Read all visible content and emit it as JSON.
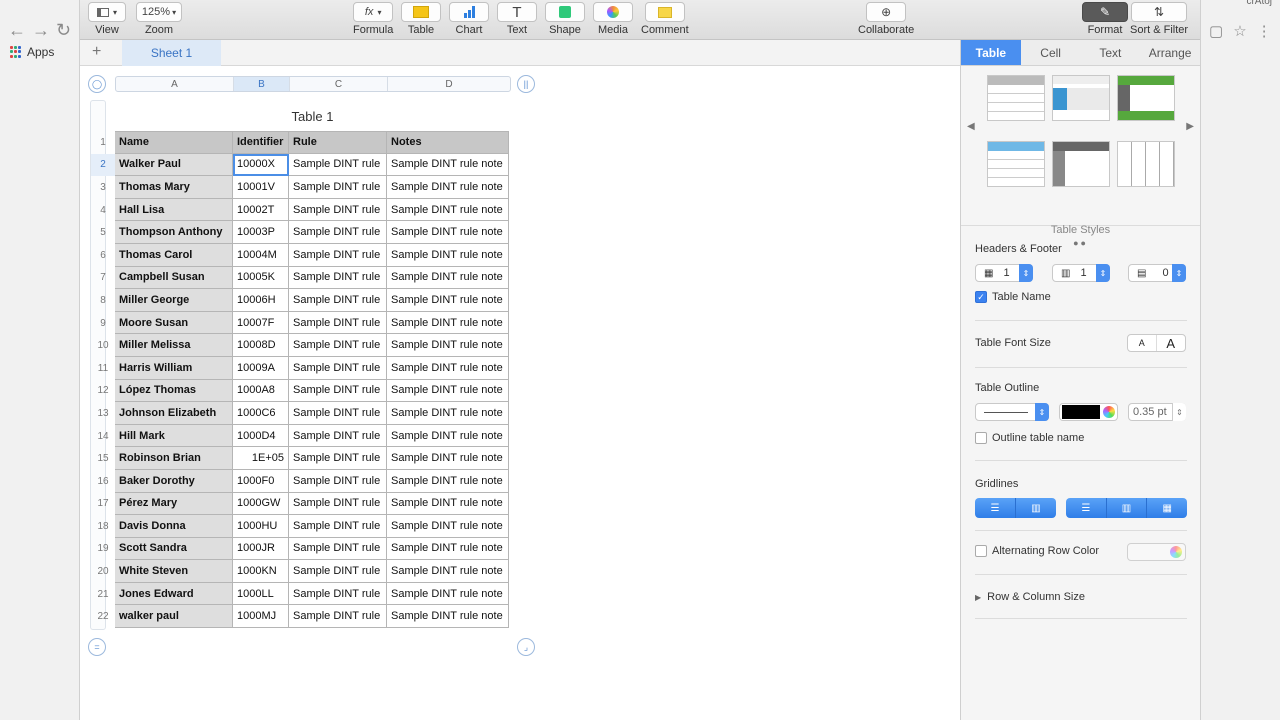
{
  "browser": {
    "apps_label": "Apps",
    "corner_text": "crAtoj"
  },
  "toolbar": {
    "view_label": "View",
    "zoom_value": "125%",
    "zoom_label": "Zoom",
    "formula_label": "Formula",
    "formula_icon_text": "fx",
    "table_label": "Table",
    "chart_label": "Chart",
    "text_label": "Text",
    "text_icon": "T",
    "shape_label": "Shape",
    "media_label": "Media",
    "comment_label": "Comment",
    "collaborate_label": "Collaborate",
    "format_label": "Format",
    "sort_filter_label": "Sort & Filter"
  },
  "sheet_tabs": [
    {
      "label": "Sheet 1",
      "active": true
    }
  ],
  "table": {
    "title": "Table 1",
    "column_letters": [
      "A",
      "B",
      "C",
      "D"
    ],
    "selected_column": "B",
    "headers": [
      "Name",
      "Identifier",
      "Rule",
      "Notes"
    ],
    "rows": [
      [
        "Walker  Paul",
        "10000X",
        "Sample DINT rule",
        "Sample DINT rule note"
      ],
      [
        "Thomas  Mary",
        "10001V",
        "Sample DINT rule",
        "Sample DINT rule note"
      ],
      [
        "Hall  Lisa",
        "10002T",
        "Sample DINT rule",
        "Sample DINT rule note"
      ],
      [
        "Thompson  Anthony",
        "10003P",
        "Sample DINT rule",
        "Sample DINT rule note"
      ],
      [
        "Thomas  Carol",
        "10004M",
        "Sample DINT rule",
        "Sample DINT rule note"
      ],
      [
        "Campbell  Susan",
        "10005K",
        "Sample DINT rule",
        "Sample DINT rule note"
      ],
      [
        "Miller  George",
        "10006H",
        "Sample DINT rule",
        "Sample DINT rule note"
      ],
      [
        "Moore  Susan",
        "10007F",
        "Sample DINT rule",
        "Sample DINT rule note"
      ],
      [
        "Miller  Melissa",
        "10008D",
        "Sample DINT rule",
        "Sample DINT rule note"
      ],
      [
        "Harris  William",
        "10009A",
        "Sample DINT rule",
        "Sample DINT rule note"
      ],
      [
        "López  Thomas",
        "1000A8",
        "Sample DINT rule",
        "Sample DINT rule note"
      ],
      [
        "Johnson  Elizabeth",
        "1000C6",
        "Sample DINT rule",
        "Sample DINT rule note"
      ],
      [
        "Hill  Mark",
        "1000D4",
        "Sample DINT rule",
        "Sample DINT rule note"
      ],
      [
        "Robinson  Brian",
        "1E+05",
        "Sample DINT rule",
        "Sample DINT rule note"
      ],
      [
        "Baker  Dorothy",
        "1000F0",
        "Sample DINT rule",
        "Sample DINT rule note"
      ],
      [
        "Pérez  Mary",
        "1000GW",
        "Sample DINT rule",
        "Sample DINT rule note"
      ],
      [
        "Davis  Donna",
        "1000HU",
        "Sample DINT rule",
        "Sample DINT rule note"
      ],
      [
        "Scott  Sandra",
        "1000JR",
        "Sample DINT rule",
        "Sample DINT rule note"
      ],
      [
        "White  Steven",
        "1000KN",
        "Sample DINT rule",
        "Sample DINT rule note"
      ],
      [
        "Jones  Edward",
        "1000LL",
        "Sample DINT rule",
        "Sample DINT rule note"
      ],
      [
        "walker  paul",
        "1000MJ",
        "Sample DINT rule",
        "Sample DINT rule note"
      ]
    ],
    "right_aligned_values": [
      "1E+05"
    ],
    "selected_cell": "B2"
  },
  "inspector": {
    "tabs": [
      "Table",
      "Cell",
      "Text",
      "Arrange"
    ],
    "active_tab": "Table",
    "table_styles_label": "Table Styles",
    "headers_footer_label": "Headers & Footer",
    "header_rows": "1",
    "header_columns": "1",
    "footer_rows": "0",
    "table_name_label": "Table Name",
    "table_name_checked": true,
    "font_size_label": "Table Font Size",
    "font_small": "A",
    "font_large": "A",
    "outline_label": "Table Outline",
    "outline_width": "0.35 pt",
    "outline_color": "#000000",
    "outline_table_name_label": "Outline table name",
    "outline_table_name_checked": false,
    "gridlines_label": "Gridlines",
    "alternating_label": "Alternating Row Color",
    "alternating_checked": false,
    "row_col_size_label": "Row & Column Size",
    "accent_color": "#4a8ff0"
  }
}
